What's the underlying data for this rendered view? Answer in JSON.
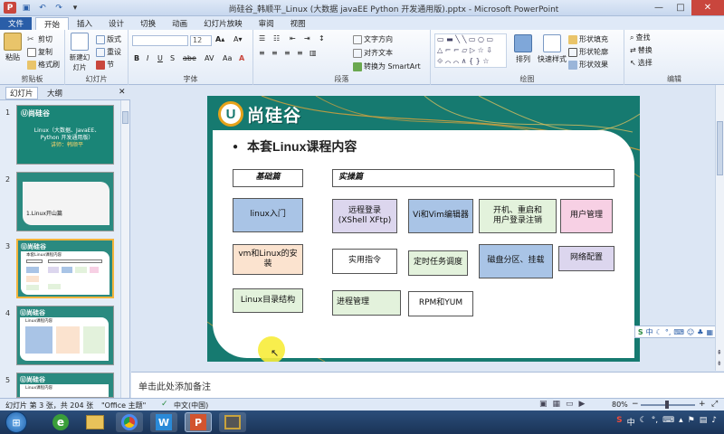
{
  "window": {
    "title": "尚硅谷_韩顺平_Linux (大数据 javaEE Python 开发通用版).pptx - Microsoft PowerPoint",
    "controls": {
      "minimize": "—",
      "maximize": "□",
      "close": "✕"
    }
  },
  "tabs": [
    "文件",
    "开始",
    "插入",
    "设计",
    "切换",
    "动画",
    "幻灯片放映",
    "审阅",
    "视图"
  ],
  "ribbon": {
    "clipboard": {
      "label": "剪贴板",
      "paste": "粘贴",
      "cut": "剪切",
      "copy": "复制",
      "format_painter": "格式刷"
    },
    "slides": {
      "label": "幻灯片",
      "new_slide": "新建幻灯片",
      "layout": "版式",
      "reset": "重设",
      "section": "节"
    },
    "font": {
      "label": "字体",
      "size": "12"
    },
    "paragraph": {
      "label": "段落",
      "text_direction": "文字方向",
      "align_text": "对齐文本",
      "smartart": "转换为 SmartArt"
    },
    "drawing": {
      "label": "绘图",
      "arrange": "排列",
      "quick_styles": "快速样式",
      "shape_fill": "形状填充",
      "shape_outline": "形状轮廓",
      "shape_effects": "形状效果"
    },
    "editing": {
      "label": "编辑",
      "find": "查找",
      "replace": "替换",
      "select": "选择"
    }
  },
  "left_panel": {
    "tabs": [
      "幻灯片",
      "大纲"
    ],
    "close": "✕",
    "thumbnails": [
      {
        "num": "1",
        "lines": [
          "Linux（大数据、JavaEE、",
          "Python 开发通用版）",
          "讲师：韩顺平"
        ]
      },
      {
        "num": "2",
        "lines": [
          "1.Linux开山篇"
        ]
      },
      {
        "num": "3",
        "lines": [
          "本套Linux课程内容"
        ]
      },
      {
        "num": "4",
        "lines": [
          "Linux课程内容"
        ]
      },
      {
        "num": "5",
        "lines": [
          "Linux课程内容"
        ]
      }
    ]
  },
  "slide": {
    "logo_text": "尚硅谷",
    "title": "本套Linux课程内容",
    "basic_header": "基础篇",
    "practical_header": "实操篇",
    "boxes": [
      {
        "text": "linux入门"
      },
      {
        "text": "vm和Linux的安装"
      },
      {
        "text": "Linux目录结构"
      },
      {
        "text": "远程登录\n(XShell XFtp)"
      },
      {
        "text": "Vi和Vim编辑器"
      },
      {
        "text": "开机、重启和\n用户登录注销"
      },
      {
        "text": "用户管理"
      },
      {
        "text": "实用指令"
      },
      {
        "text": "定时任务调度"
      },
      {
        "text": "磁盘分区、挂载"
      },
      {
        "text": "网络配置"
      },
      {
        "text": "进程管理"
      },
      {
        "text": "RPM和YUM"
      }
    ]
  },
  "notes_placeholder": "单击此处添加备注",
  "status": {
    "slide_info": "幻灯片 第 3 张，共 204 张",
    "theme": "\"Office 主题\"",
    "language": "中文(中国)",
    "zoom": "80%"
  },
  "ime_bar": "中",
  "taskbar": {
    "clock": ""
  },
  "colors": {
    "slide_teal": "#167a70",
    "box_blue": "#a9c4e6",
    "box_peach": "#fbe3cf",
    "box_green": "#e3f2dc",
    "box_lavender": "#dcd6ee",
    "box_pink": "#f7d0e4"
  }
}
